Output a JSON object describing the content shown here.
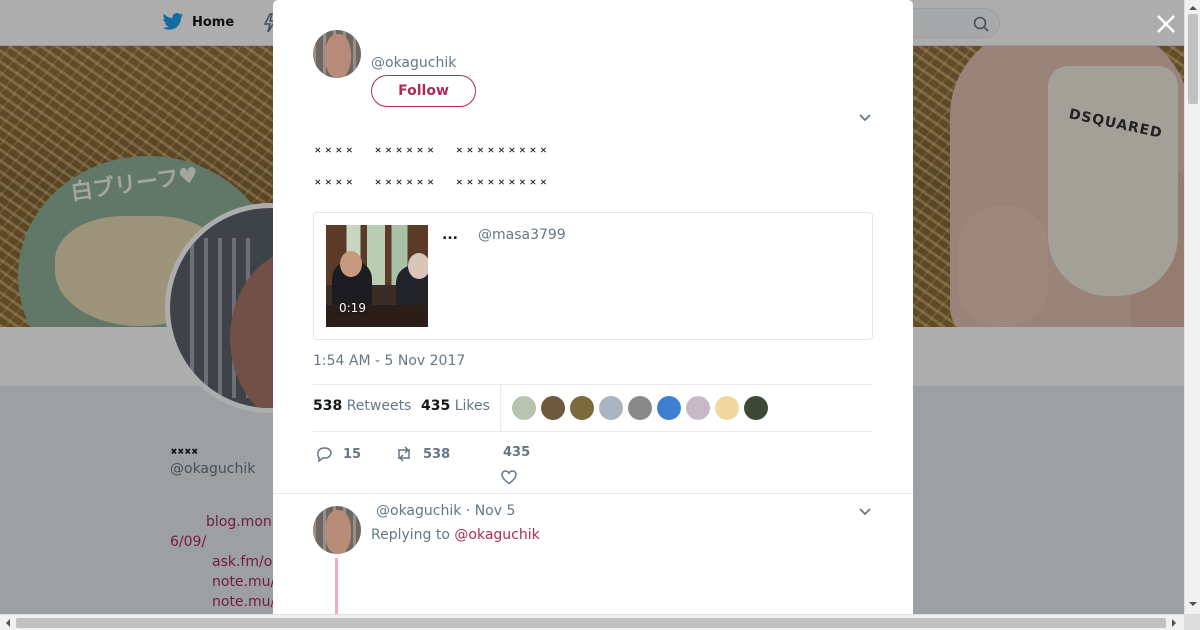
{
  "nav": {
    "home_label": "Home"
  },
  "profile": {
    "name": "𝅃𝅃𝅃𝅃",
    "handle": "@okaguchik",
    "banner_badge_text": "白ブリーフ♥",
    "banner_brand_text": "DSQUARED",
    "links": [
      "blog.mon",
      "6/09/",
      "ask.fm/o",
      "note.mu/",
      "note.mu/"
    ]
  },
  "tweet": {
    "author_handle": "@okaguchik",
    "follow_label": "Follow",
    "text_lines": [
      "𝅃𝅃𝅃𝅃 𝅃𝅃𝅃𝅃𝅃𝅃 𝅃𝅃𝅃𝅃𝅃𝅃𝅃𝅃𝅃",
      "𝅃𝅃𝅃𝅃 𝅃𝅃𝅃𝅃𝅃𝅃 𝅃𝅃𝅃𝅃𝅃𝅃𝅃𝅃𝅃"
    ],
    "quote": {
      "author_name": "...",
      "author_handle": "@masa3799",
      "video_duration": "0:19"
    },
    "timestamp": "1:54 AM - 5 Nov 2017",
    "retweets_count": "538",
    "retweets_label": "Retweets",
    "likes_count": "435",
    "likes_label": "Likes",
    "liker_colors": [
      "#b8c4b0",
      "#6b5a3e",
      "#7a6a3c",
      "#a9b6c2",
      "#8a8a8a",
      "#3f7fd1",
      "#c8b8c8",
      "#f2d7a0",
      "#3c4a34"
    ],
    "actions": {
      "reply_count": "15",
      "retweet_count": "538",
      "like_count": "435"
    }
  },
  "reply": {
    "author_handle": "@okaguchik",
    "date": "Nov 5",
    "replying_prefix": "Replying to",
    "replying_to": "@okaguchik"
  },
  "colors": {
    "accent": "#ab2b5a",
    "muted": "#657786",
    "text": "#14171a"
  }
}
